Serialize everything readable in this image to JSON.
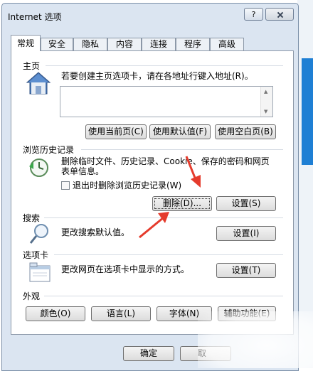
{
  "window": {
    "title": "Internet 选项",
    "help_label": "?"
  },
  "tabs": [
    {
      "label": "常规"
    },
    {
      "label": "安全"
    },
    {
      "label": "隐私"
    },
    {
      "label": "内容"
    },
    {
      "label": "连接"
    },
    {
      "label": "程序"
    },
    {
      "label": "高级"
    }
  ],
  "homepage": {
    "heading": "主页",
    "description": "若要创建主页选项卡，请在各地址行键入地址(R)。",
    "url_value": "",
    "buttons": [
      "使用当前页(C)",
      "使用默认值(F)",
      "使用空白页(B)"
    ]
  },
  "history": {
    "heading": "浏览历史记录",
    "description_line1": "删除临时文件、历史记录、Cookie、保存的密码和网页",
    "description_line2": "表单信息。",
    "checkbox_label": "退出时删除浏览历史记录(W)",
    "delete_button": "删除(D)...",
    "settings_button": "设置(S)"
  },
  "search": {
    "heading": "搜索",
    "description": "更改搜索默认值。",
    "settings_button": "设置(I)"
  },
  "tabs_section": {
    "heading": "选项卡",
    "description": "更改网页在选项卡中显示的方式。",
    "settings_button": "设置(T)"
  },
  "appearance": {
    "heading": "外观",
    "buttons": [
      "颜色(O)",
      "语言(L)",
      "字体(N)",
      "辅助功能(E)"
    ]
  },
  "footer": {
    "ok_button": "确定",
    "cancel_button_partial": "取"
  },
  "colors": {
    "annotation_arrow": "#e53b2c",
    "accent_blue": "#1e7fd4"
  }
}
